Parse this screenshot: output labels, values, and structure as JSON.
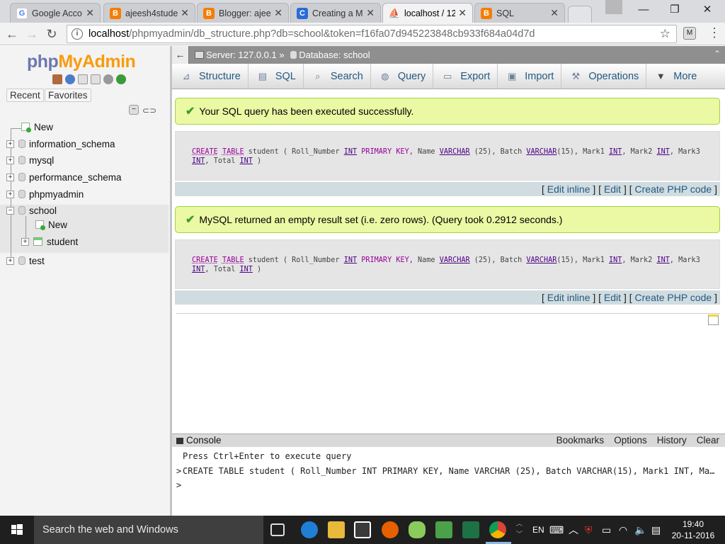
{
  "browser": {
    "tabs": [
      {
        "title": "Google Acco",
        "favicon": "google-g-icon",
        "color": "#4285f4"
      },
      {
        "title": "ajeesh4stude",
        "favicon": "blogger-icon",
        "color": "#f57d00"
      },
      {
        "title": "Blogger: ajee",
        "favicon": "blogger-icon",
        "color": "#f57d00"
      },
      {
        "title": "Creating a M",
        "favicon": "c-icon",
        "color": "#2a6cd6"
      },
      {
        "title": "localhost / 12",
        "favicon": "phpmyadmin-icon",
        "color": "#f89c0e"
      },
      {
        "title": "SQL",
        "favicon": "blogger-icon",
        "color": "#f57d00"
      }
    ],
    "address": {
      "host": "localhost",
      "path": "/phpmyadmin/db_structure.php?db=school&token=f16fa07d945223848cb933f684a04d7d"
    }
  },
  "sidebar": {
    "logo_php": "php",
    "logo_myadmin": "MyAdmin",
    "recent_label": "Recent",
    "favorites_label": "Favorites",
    "tree": [
      {
        "label": "New"
      },
      {
        "label": "information_schema"
      },
      {
        "label": "mysql"
      },
      {
        "label": "performance_schema"
      },
      {
        "label": "phpmyadmin"
      },
      {
        "label": "school"
      },
      {
        "label": "New"
      },
      {
        "label": "student"
      },
      {
        "label": "test"
      }
    ]
  },
  "breadcrumb": {
    "server": "Server: 127.0.0.1 »",
    "database": "Database: school"
  },
  "menu": [
    {
      "label": "Structure",
      "icon": "structure-icon"
    },
    {
      "label": "SQL",
      "icon": "sql-icon"
    },
    {
      "label": "Search",
      "icon": "search-icon"
    },
    {
      "label": "Query",
      "icon": "query-icon"
    },
    {
      "label": "Export",
      "icon": "export-icon"
    },
    {
      "label": "Import",
      "icon": "import-icon"
    },
    {
      "label": "Operations",
      "icon": "wrench-icon"
    },
    {
      "label": "More",
      "icon": "triangle-down-icon"
    }
  ],
  "messages": {
    "success1": "Your SQL query has been executed successfully.",
    "success2": "MySQL returned an empty result set (i.e. zero rows). (Query took 0.2912 seconds.)",
    "sql_parts": {
      "create": "CREATE",
      "table": "TABLE",
      "name": "student (",
      "c1": "Roll_Number",
      "int": "INT",
      "pk": "PRIMARY KEY,",
      "c2": "Name",
      "varchar": "VARCHAR",
      "len25": "(25),",
      "c3": "Batch",
      "len15": "(15),",
      "c4": "Mark1",
      "c5": "Mark2",
      "c6": "Mark3",
      "c7": "Total",
      "comma": ",",
      "close": ")"
    },
    "edit_inline": "Edit inline",
    "edit": "Edit",
    "create_php": "Create PHP code"
  },
  "console": {
    "title": "Console",
    "options": [
      "Bookmarks",
      "Options",
      "History",
      "Clear"
    ],
    "hint": "Press Ctrl+Enter to execute query",
    "history_line": "CREATE TABLE student ( Roll_Number INT PRIMARY KEY, Name VARCHAR (25), Batch VARCHAR(15), Mark1 INT, Ma…",
    "prompt": ">"
  },
  "taskbar": {
    "search_placeholder": "Search the web and Windows",
    "lang": "EN",
    "time": "19:40",
    "date": "20-11-2016"
  }
}
